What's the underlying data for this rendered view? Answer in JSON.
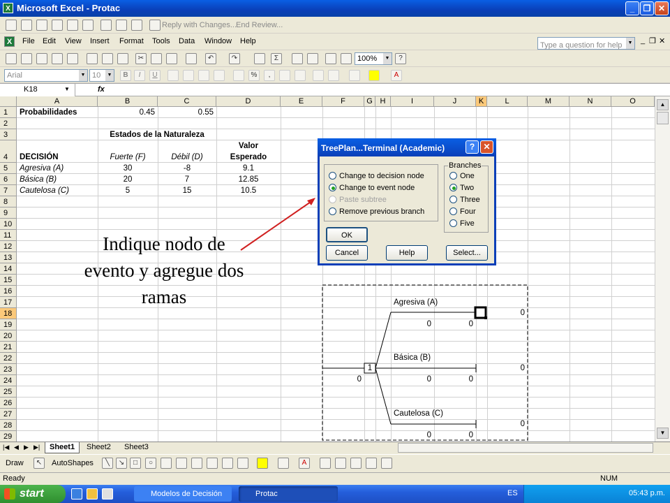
{
  "window": {
    "title": "Microsoft Excel - Protac",
    "app_icon": "X"
  },
  "reviewing_toolbar": {
    "reply_with_changes": "Reply with Changes...",
    "end_review": "End Review..."
  },
  "menu": {
    "items": [
      "File",
      "Edit",
      "View",
      "Insert",
      "Format",
      "Tools",
      "Data",
      "Window",
      "Help"
    ],
    "help_placeholder": "Type a question for help"
  },
  "standard_toolbar": {
    "zoom": "100%"
  },
  "formatting_toolbar": {
    "font": "Arial",
    "size": "10"
  },
  "formula_bar": {
    "name_box": "K18",
    "fx": "fx"
  },
  "columns": [
    "A",
    "B",
    "C",
    "D",
    "E",
    "F",
    "G",
    "H",
    "I",
    "J",
    "K",
    "L",
    "M",
    "N",
    "O"
  ],
  "rows": [
    "1",
    "2",
    "3",
    "4",
    "5",
    "6",
    "7",
    "8",
    "9",
    "10",
    "11",
    "12",
    "13",
    "14",
    "15",
    "16",
    "17",
    "18",
    "19",
    "20",
    "21",
    "22",
    "23",
    "24",
    "25",
    "26",
    "27",
    "28",
    "29"
  ],
  "sheet": {
    "probabilidades": "Probabilidades",
    "p_fuerte": "0.45",
    "p_debil": "0.55",
    "estados": "Estados de la Naturaleza",
    "valor": "Valor",
    "decision": "DECISIÓN",
    "fuerte": "Fuerte (F)",
    "debil": "Débil (D)",
    "esperado": "Esperado",
    "rows": [
      {
        "name": "Agresiva (A)",
        "f": "30",
        "d": "-8",
        "ev": "9.1"
      },
      {
        "name": "Básica (B)",
        "f": "20",
        "d": "7",
        "ev": "12.85"
      },
      {
        "name": "Cautelosa (C)",
        "f": "5",
        "d": "15",
        "ev": "10.5"
      }
    ]
  },
  "tree": {
    "node_label": "1",
    "root_value": "0",
    "branches": [
      {
        "name": "Agresiva (A)",
        "v1": "0",
        "v2": "0",
        "terminal": "0"
      },
      {
        "name": "Básica (B)",
        "v1": "0",
        "v2": "0",
        "terminal": "0"
      },
      {
        "name": "Cautelosa (C)",
        "v1": "0",
        "v2": "0",
        "terminal": "0"
      }
    ]
  },
  "dialog": {
    "title": "TreePlan...Terminal  (Academic)",
    "options": [
      "Change to decision node",
      "Change to event node",
      "Paste subtree",
      "Remove previous branch"
    ],
    "branches_label": "Branches",
    "branch_options": [
      "One",
      "Two",
      "Three",
      "Four",
      "Five"
    ],
    "ok": "OK",
    "cancel": "Cancel",
    "help": "Help",
    "select": "Select..."
  },
  "annotation": "Indique nodo de evento y agregue dos ramas",
  "sheet_tabs": [
    "Sheet1",
    "Sheet2",
    "Sheet3"
  ],
  "draw_toolbar": {
    "draw": "Draw",
    "autoshapes": "AutoShapes"
  },
  "status": {
    "ready": "Ready",
    "num": "NUM"
  },
  "taskbar": {
    "start": "start",
    "tasks": [
      "Modelos de Decisión",
      "Protac"
    ],
    "lang": "ES",
    "clock": "05:43 p.m."
  }
}
